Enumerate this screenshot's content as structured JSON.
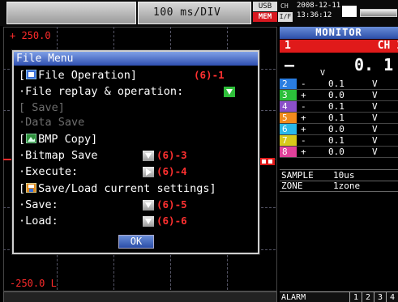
{
  "header": {
    "sampling_rate": "100 ms/DIV",
    "usb_badge": "USB",
    "mem_badge": "MEM",
    "ch_badge": "CH",
    "if_badge": "I/F",
    "date": "2008-12-11",
    "time": "13:36:12"
  },
  "chart": {
    "scale_top": "+ 250.0",
    "scale_bottom": "-250.0 L",
    "trace_color": "#e01a1a"
  },
  "monitor": {
    "title": "MONITOR",
    "ch1": {
      "number": "1",
      "name": "CH 1",
      "sign": "—",
      "value": "0. 1",
      "unit": "V",
      "color": "#e01a1a"
    },
    "channels": [
      {
        "number": "2",
        "sign": "-",
        "value": "0.1",
        "unit": "V",
        "color": "#2a7de1"
      },
      {
        "number": "3",
        "sign": "+",
        "value": "0.0",
        "unit": "V",
        "color": "#2bbf3a"
      },
      {
        "number": "4",
        "sign": "-",
        "value": "0.1",
        "unit": "V",
        "color": "#8a4fc8"
      },
      {
        "number": "5",
        "sign": "+",
        "value": "0.1",
        "unit": "V",
        "color": "#f08a1c"
      },
      {
        "number": "6",
        "sign": "+",
        "value": "0.0",
        "unit": "V",
        "color": "#2ab8e8"
      },
      {
        "number": "7",
        "sign": "-",
        "value": "0.1",
        "unit": "V",
        "color": "#d8c81a"
      },
      {
        "number": "8",
        "sign": "+",
        "value": "0.0",
        "unit": "V",
        "color": "#e0409a"
      }
    ],
    "sample_label": "SAMPLE",
    "sample_value": "10us",
    "zone_label": "ZONE",
    "zone_value": "1zone"
  },
  "alarm": {
    "label": "ALARM",
    "cells": [
      "1",
      "2",
      "3",
      "4"
    ]
  },
  "file_menu": {
    "title": "File Menu",
    "file_operation_header": "[",
    "file_operation_label": "File Operation]",
    "file_operation_ref": "(6)-1",
    "file_replay_label": "·File replay & operation:",
    "save_disabled_label": "[  Save]",
    "data_save_label": "·Data Save",
    "bmp_copy_label": "BMP Copy]",
    "bitmap_save_label": "·Bitmap Save",
    "bitmap_save_ref": "(6)-3",
    "execute_label": "·Execute:",
    "execute_ref": "(6)-4",
    "settings_label": "Save/Load current settings]",
    "save_label": "·Save:",
    "save_ref": "(6)-5",
    "load_label": "·Load:",
    "load_ref": "(6)-6",
    "ok_label": "OK"
  }
}
